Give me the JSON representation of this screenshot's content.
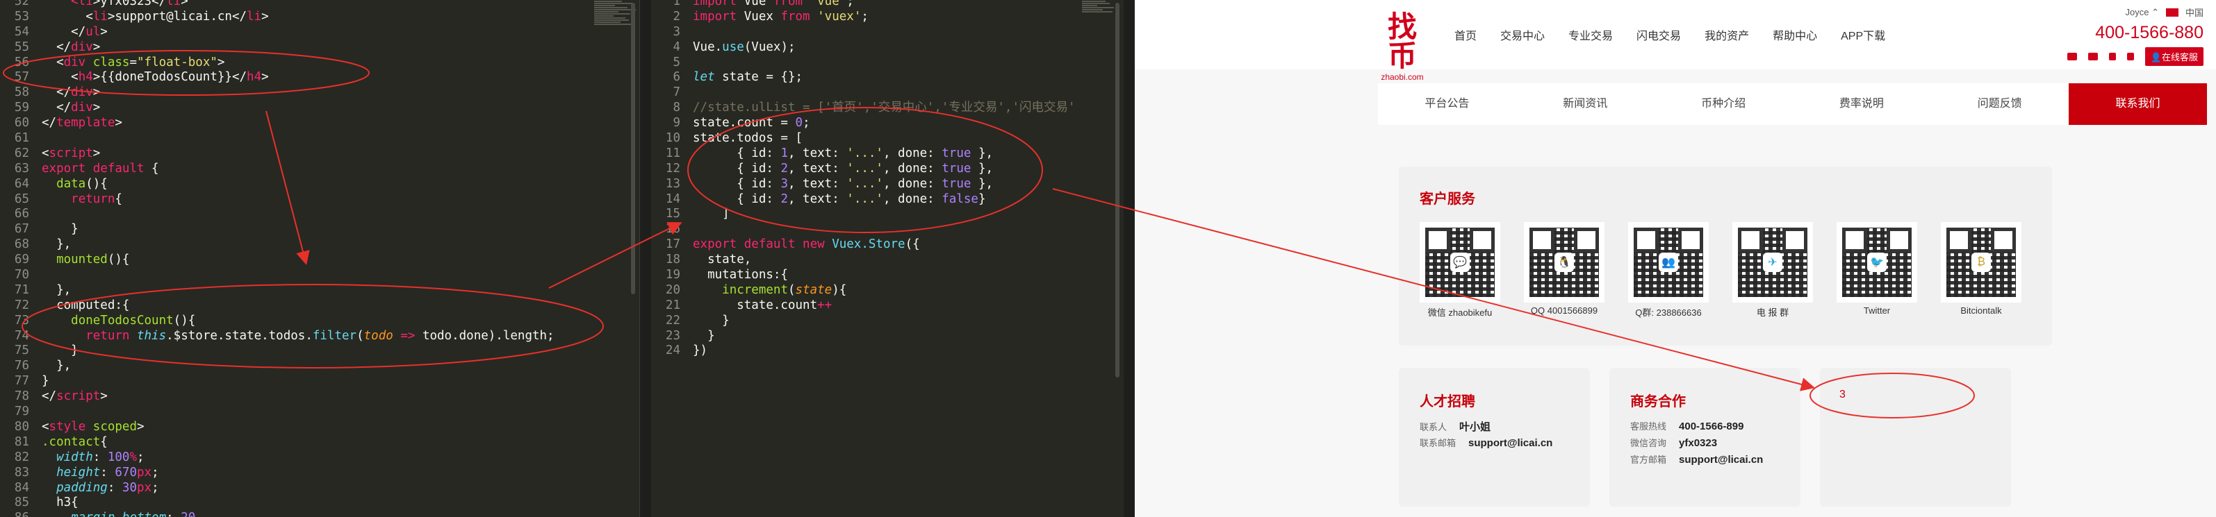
{
  "editor_left": {
    "lines": [
      {
        "n": "52",
        "html": "<span class='t-tag'>    &lt;li</span>&gt;yfx0323&lt;/<span class='t-tag'>li</span>&gt;"
      },
      {
        "n": "53",
        "html": "      &lt;<span class='t-tag'>li</span>&gt;support@licai.cn&lt;/<span class='t-tag'>li</span>&gt;"
      },
      {
        "n": "54",
        "html": "    &lt;/<span class='t-tag'>ul</span>&gt;"
      },
      {
        "n": "55",
        "html": "  &lt;/<span class='t-tag'>div</span>&gt;"
      },
      {
        "n": "56",
        "html": "  &lt;<span class='t-tag'>div</span> <span class='t-attr'>class</span>=<span class='t-str'>\"float-box\"</span>&gt;"
      },
      {
        "n": "57",
        "html": "    &lt;<span class='t-tag'>h4</span>&gt;{{doneTodosCount}}&lt;/<span class='t-tag'>h4</span>&gt;"
      },
      {
        "n": "58",
        "html": "  &lt;/<span class='t-tag'>div</span>&gt;"
      },
      {
        "n": "59",
        "html": "  &lt;/<span class='t-tag'>div</span>&gt;"
      },
      {
        "n": "60",
        "html": "&lt;/<span class='t-tag'>template</span>&gt;"
      },
      {
        "n": "61",
        "html": ""
      },
      {
        "n": "62",
        "html": "&lt;<span class='t-tag'>script</span>&gt;"
      },
      {
        "n": "63",
        "html": "<span class='t-kw'>export default</span> {"
      },
      {
        "n": "64",
        "html": "  <span class='t-fn'>data</span>(){"
      },
      {
        "n": "65",
        "html": "    <span class='t-kw'>return</span>{"
      },
      {
        "n": "66",
        "html": ""
      },
      {
        "n": "67",
        "html": "    }"
      },
      {
        "n": "68",
        "html": "  },"
      },
      {
        "n": "69",
        "html": "  <span class='t-fn'>mounted</span>(){"
      },
      {
        "n": "70",
        "html": ""
      },
      {
        "n": "71",
        "html": "  },"
      },
      {
        "n": "72",
        "html": "  computed:{"
      },
      {
        "n": "73",
        "html": "    <span class='t-fn'>doneTodosCount</span>(){"
      },
      {
        "n": "74",
        "html": "      <span class='t-kw'>return</span> <span class='t-ital'>this</span>.$store.state.todos.<span class='t-prop'>filter</span>(<span class='t-param'>todo</span> <span class='t-kw'>=&gt;</span> todo.done).length;"
      },
      {
        "n": "75",
        "html": "    }"
      },
      {
        "n": "76",
        "html": "  },"
      },
      {
        "n": "77",
        "html": "}"
      },
      {
        "n": "78",
        "html": "&lt;/<span class='t-tag'>script</span>&gt;"
      },
      {
        "n": "79",
        "html": ""
      },
      {
        "n": "80",
        "html": "&lt;<span class='t-tag'>style</span> <span class='t-attr'>scoped</span>&gt;"
      },
      {
        "n": "81",
        "html": "<span class='t-attr'>.contact</span>{"
      },
      {
        "n": "82",
        "html": "  <span class='t-ital'>width</span>: <span class='t-num'>100</span><span class='t-kw'>%</span>;"
      },
      {
        "n": "83",
        "html": "  <span class='t-ital'>height</span>: <span class='t-num'>670</span><span class='t-kw'>px</span>;"
      },
      {
        "n": "84",
        "html": "  <span class='t-ital'>padding</span>: <span class='t-num'>30</span><span class='t-kw'>px</span>;"
      },
      {
        "n": "85",
        "html": "  h3{"
      },
      {
        "n": "86",
        "html": "    <span class='t-ital'>margin-bottom</span>: <span class='t-num'>20</span>"
      }
    ]
  },
  "editor_mid": {
    "lines": [
      {
        "n": "1",
        "html": "<span class='t-kw'>import</span> Vue <span class='t-kw'>from</span> <span class='t-str'>'vue'</span>;"
      },
      {
        "n": "2",
        "html": "<span class='t-kw'>import</span> Vuex <span class='t-kw'>from</span> <span class='t-str'>'vuex'</span>;"
      },
      {
        "n": "3",
        "html": ""
      },
      {
        "n": "4",
        "html": "Vue.<span class='t-prop'>use</span>(Vuex);"
      },
      {
        "n": "5",
        "html": ""
      },
      {
        "n": "6",
        "html": "<span class='t-ital'>let</span> state = {};"
      },
      {
        "n": "7",
        "html": ""
      },
      {
        "n": "8",
        "html": "<span class='t-com'>//state.ulList = ['首页','交易中心','专业交易','闪电交易'</span>"
      },
      {
        "n": "9",
        "html": "state.count = <span class='t-num'>0</span>;"
      },
      {
        "n": "10",
        "html": "state.todos = ["
      },
      {
        "n": "11",
        "html": "      { id: <span class='t-num'>1</span>, text: <span class='t-str'>'...'</span>, done: <span class='t-num'>true</span> },"
      },
      {
        "n": "12",
        "html": "      { id: <span class='t-num'>2</span>, text: <span class='t-str'>'...'</span>, done: <span class='t-num'>true</span> },"
      },
      {
        "n": "13",
        "html": "      { id: <span class='t-num'>3</span>, text: <span class='t-str'>'...'</span>, done: <span class='t-num'>true</span> },"
      },
      {
        "n": "14",
        "html": "      { id: <span class='t-num'>2</span>, text: <span class='t-str'>'...'</span>, done: <span class='t-num'>false</span>}"
      },
      {
        "n": "15",
        "html": "    ]"
      },
      {
        "n": "16",
        "html": ""
      },
      {
        "n": "17",
        "html": "<span class='t-kw'>export default new</span> <span class='t-prop'>Vuex.Store</span>({"
      },
      {
        "n": "18",
        "html": "  state,"
      },
      {
        "n": "19",
        "html": "  mutations:{"
      },
      {
        "n": "20",
        "html": "    <span class='t-fn'>increment</span>(<span class='t-param'>state</span>){"
      },
      {
        "n": "21",
        "html": "      state.count<span class='t-kw'>++</span>"
      },
      {
        "n": "22",
        "html": "    }"
      },
      {
        "n": "23",
        "html": "  }"
      },
      {
        "n": "24",
        "html": "})"
      }
    ]
  },
  "site": {
    "logo_mark": "找币",
    "logo_sub": "zhaobi.com",
    "nav": [
      "首页",
      "交易中心",
      "专业交易",
      "闪电交易",
      "我的资产",
      "帮助中心",
      "APP下载"
    ],
    "user_name": "Joyce",
    "region": "中国",
    "phone": "400-1566-880",
    "report_label": "在线客服",
    "tabs": [
      "平台公告",
      "新闻资讯",
      "币种介绍",
      "费率说明",
      "问题反馈",
      "联系我们"
    ],
    "service_title": "客户服务",
    "qr_items": [
      {
        "label": "微信 zhaobikefu",
        "badge": "💬",
        "color": "#1aad19"
      },
      {
        "label": "QQ 4001566899",
        "badge": "🐧",
        "color": "#12b7f5"
      },
      {
        "label": "Q群: 238866636",
        "badge": "👥",
        "color": "#f5a623"
      },
      {
        "label": "电 报 群",
        "badge": "✈",
        "color": "#2ca5e0"
      },
      {
        "label": "Twitter",
        "badge": "🐦",
        "color": "#1da1f2"
      },
      {
        "label": "Bitciontalk",
        "badge": "₿",
        "color": "#c9a227"
      }
    ],
    "recruit": {
      "title": "人才招聘",
      "rows": [
        {
          "k": "联系人",
          "v": "叶小姐"
        },
        {
          "k": "联系邮箱",
          "v": "support@licai.cn"
        }
      ]
    },
    "business": {
      "title": "商务合作",
      "rows": [
        {
          "k": "客服热线",
          "v": "400-1566-899"
        },
        {
          "k": "微信咨询",
          "v": "yfx0323"
        },
        {
          "k": "官方邮箱",
          "v": "support@licai.cn"
        }
      ]
    },
    "float_value": "3"
  },
  "colors": {
    "brand": "#c7000b",
    "annotation": "#e8302b"
  }
}
